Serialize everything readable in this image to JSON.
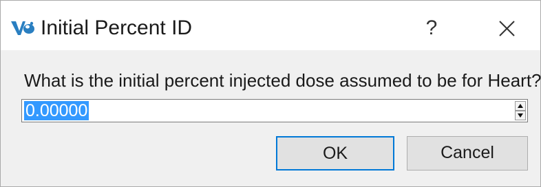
{
  "window": {
    "title": "Initial Percent ID",
    "help_glyph": "?",
    "app_icon": "app-logo-icon",
    "close_icon": "close-icon"
  },
  "prompt": "What is the initial percent injected dose assumed to be for Heart?",
  "spinbox": {
    "value": "0.00000",
    "up_icon": "spin-up-icon",
    "down_icon": "spin-down-icon"
  },
  "buttons": {
    "ok_label": "OK",
    "cancel_label": "Cancel"
  },
  "colors": {
    "accent": "#0078d7",
    "selection": "#3399ff",
    "icon_blue": "#2a7fc1"
  }
}
